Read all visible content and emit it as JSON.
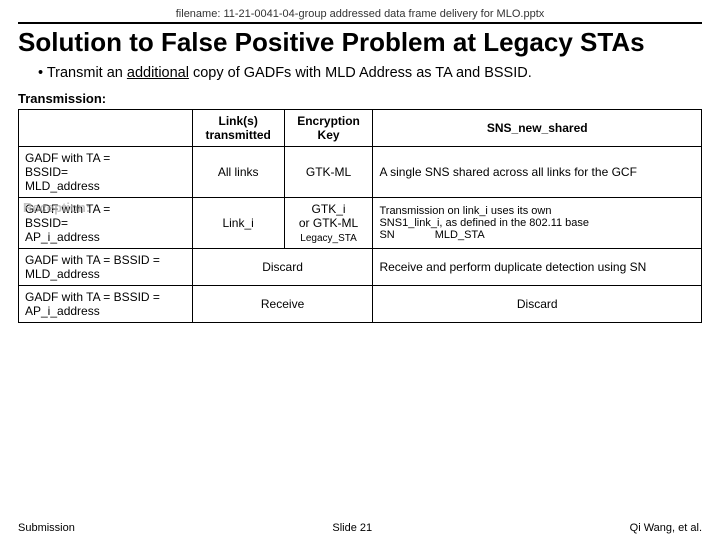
{
  "filename": "filename:  11-21-0041-04-group addressed data frame delivery for MLO.pptx",
  "title": "Solution to False Positive Problem at Legacy STAs",
  "bullet": "Transmit an additional copy of GADFs with MLD Address as TA and BSSID.",
  "bullet_underline": "additional",
  "transmission_label": "Transmission:",
  "table": {
    "headers": [
      "",
      "Link(s) transmitted",
      "Encryption Key",
      "SNS_new_shared"
    ],
    "rows": [
      {
        "col1": "GADF with TA = BSSID= MLD_address",
        "col2": "All links",
        "col3": "GTK-ML",
        "col4": "A single SNS shared across all links for the GCF"
      },
      {
        "col1_line1": "GADF with TA =",
        "col1_overlap": "Reception:",
        "col1_line2": "BSSID=",
        "col1_line3": "AP_i_address",
        "col2": "Link_i",
        "col3_line1": "GTK_i",
        "col3_line2": "or GTK-ML",
        "col3_line3": "Legacy_STA",
        "col4_line1": "Transmission on link_i uses its own",
        "col4_line2": "SNS1_link_i, as defined in the 802.11 base",
        "col4_line3": "SN",
        "col4_line4": "MLD_STA"
      },
      {
        "col1": "GADF with TA = BSSID = MLD_address",
        "col2_col3": "Discard",
        "col4": "Receive and perform duplicate detection using SN"
      },
      {
        "col1": "GADF with TA = BSSID = AP_i_address",
        "col2_col3": "Receive",
        "col4": "Discard"
      }
    ]
  },
  "footer": {
    "left": "Submission",
    "center": "Slide 21",
    "right": "Qi Wang, et al."
  }
}
